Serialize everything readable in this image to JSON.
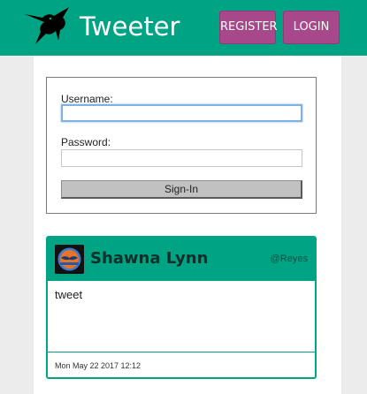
{
  "header": {
    "brand": "Tweeter",
    "logo_icon": "hummingbird-icon",
    "nav": {
      "register_label": "REGISTER",
      "login_label": "LOGIN"
    }
  },
  "login_form": {
    "username_label": "Username:",
    "username_value": "",
    "password_label": "Password:",
    "password_value": "",
    "submit_label": "Sign-In"
  },
  "tweets": [
    {
      "author": "Shawna Lynn",
      "handle": "@Reyes",
      "avatar_icon": "avatar-icon",
      "body": "tweet",
      "timestamp": "Mon May 22 2017 12:12"
    }
  ],
  "colors": {
    "primary": "#00a383",
    "accent": "#a6488a",
    "page_bg": "#ececec"
  }
}
